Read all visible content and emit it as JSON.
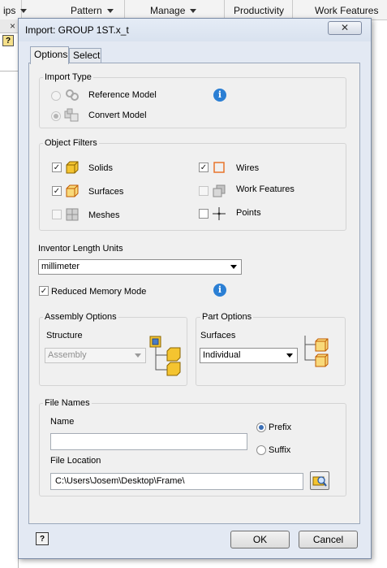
{
  "ribbon": {
    "tabs": [
      {
        "label": "ips"
      },
      {
        "label": "Pattern"
      },
      {
        "label": "Manage"
      },
      {
        "label": "Productivity"
      },
      {
        "label": "Work Features"
      }
    ]
  },
  "left_panel": {
    "close_glyph": "×"
  },
  "dialog": {
    "title": "Import:  GROUP 1ST.x_t",
    "close_glyph": "✕",
    "tabs": {
      "options": "Options",
      "select": "Select"
    },
    "import_type": {
      "label": "Import Type",
      "reference_model": "Reference Model",
      "convert_model": "Convert Model",
      "selected": "Convert Model",
      "info_glyph": "i"
    },
    "object_filters": {
      "label": "Object Filters",
      "solids": {
        "label": "Solids",
        "checked": true
      },
      "surfaces": {
        "label": "Surfaces",
        "checked": true
      },
      "meshes": {
        "label": "Meshes",
        "checked": false
      },
      "wires": {
        "label": "Wires",
        "checked": true
      },
      "work_features": {
        "label": "Work Features",
        "checked": false
      },
      "points": {
        "label": "Points",
        "checked": false
      }
    },
    "length_units": {
      "label": "Inventor Length Units",
      "value": "millimeter"
    },
    "reduced_memory": {
      "label": "Reduced Memory Mode",
      "checked": true
    },
    "assembly_options": {
      "label": "Assembly Options",
      "structure_label": "Structure",
      "structure_value": "Assembly"
    },
    "part_options": {
      "label": "Part Options",
      "surfaces_label": "Surfaces",
      "surfaces_value": "Individual"
    },
    "file_names": {
      "label": "File Names",
      "name_label": "Name",
      "name_value": "",
      "prefix": "Prefix",
      "suffix": "Suffix",
      "selected": "Prefix",
      "file_location_label": "File Location",
      "file_location_value": "C:\\Users\\Josem\\Desktop\\Frame\\"
    },
    "buttons": {
      "help": "?",
      "ok": "OK",
      "cancel": "Cancel"
    },
    "check_glyph": "✓"
  },
  "colors": {
    "info_blue": "#2b7fd4",
    "solid_yellow": "#f4c430",
    "wire_orange": "#e8742a",
    "dialog_frame": "#e3e9f3"
  },
  "icons": [
    "help-icon",
    "info-icon",
    "reference-model-icon",
    "convert-model-icon",
    "solid-icon",
    "surface-icon",
    "mesh-icon",
    "wire-icon",
    "work-feature-icon",
    "point-icon",
    "assembly-structure-icon",
    "part-surfaces-icon",
    "browse-folder-icon"
  ]
}
